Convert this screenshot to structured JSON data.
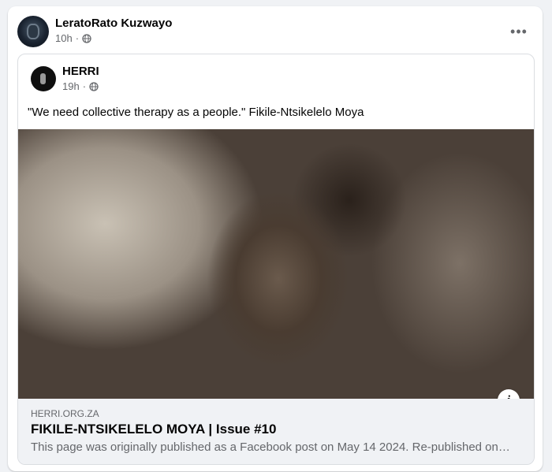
{
  "post": {
    "author": "LeratoRato Kuzwayo",
    "time": "10h",
    "more_label": "•••"
  },
  "shared_post": {
    "author": "HERRI",
    "time": "19h",
    "text": "\"We need collective therapy as a people.\" Fikile-Ntsikelelo Moya"
  },
  "link_preview": {
    "domain": "HERRI.ORG.ZA",
    "title": "FIKILE-NTSIKELELO MOYA | Issue #10",
    "description": "This page was originally published as a Facebook post on May 14 2024. Re-published on this site.",
    "info_label": "i"
  },
  "icons": {
    "privacy": "globe-icon",
    "more": "more-horizontal-icon",
    "info": "info-icon"
  },
  "colors": {
    "secondary_text": "#65676b",
    "link_box_bg": "#f0f2f5"
  }
}
